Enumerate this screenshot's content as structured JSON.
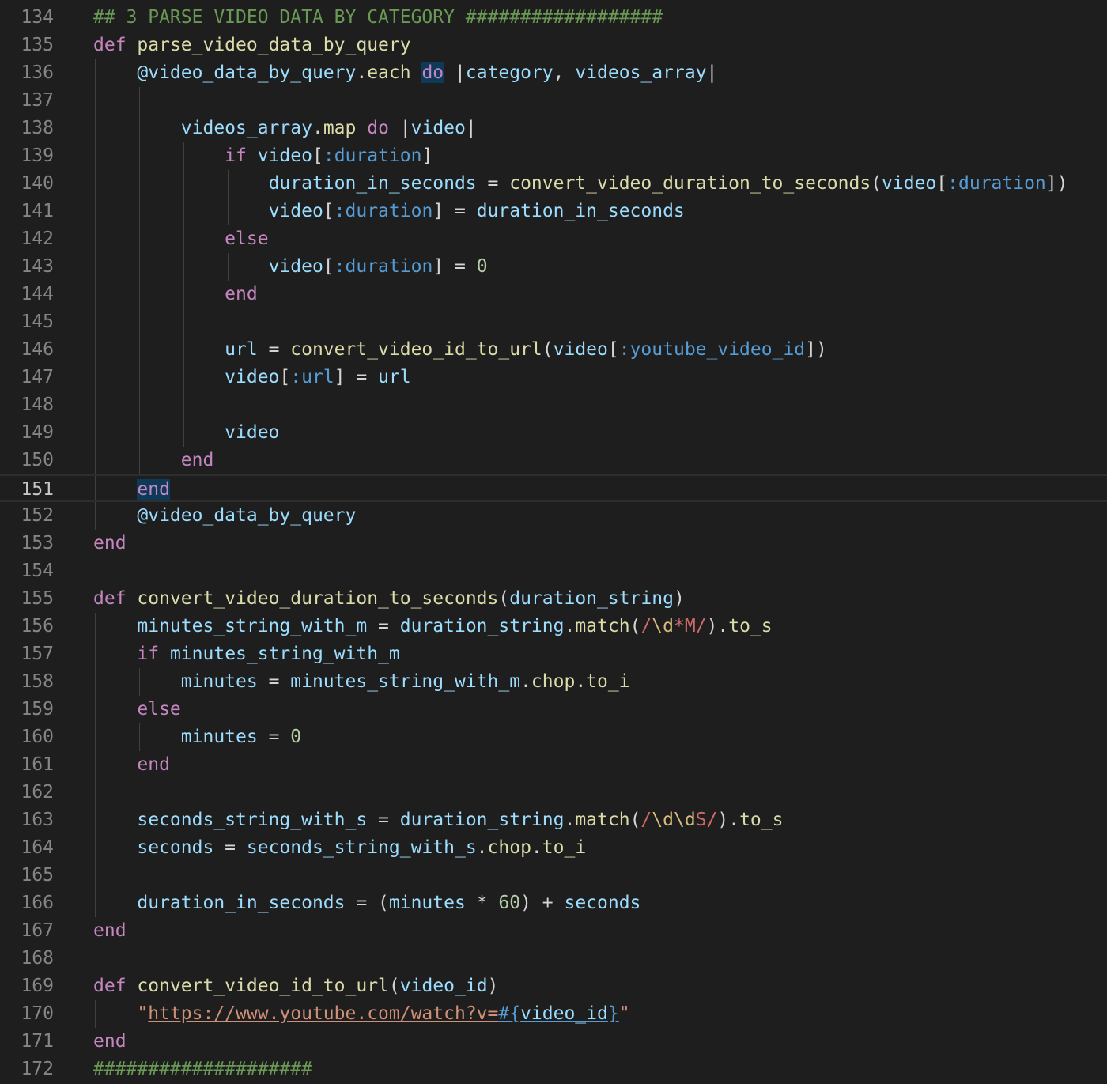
{
  "editor": {
    "language": "ruby",
    "current_line": 151,
    "lines": [
      {
        "n": "134",
        "tokens": [
          [
            "c",
            "## 3 PARSE VIDEO DATA BY CATEGORY ##################"
          ]
        ]
      },
      {
        "n": "135",
        "tokens": [
          [
            "k",
            "def"
          ],
          [
            "p",
            " "
          ],
          [
            "f",
            "parse_video_data_by_query"
          ]
        ]
      },
      {
        "n": "136",
        "tokens": [
          [
            "p",
            "    "
          ],
          [
            "v",
            "@video_data_by_query"
          ],
          [
            "p",
            "."
          ],
          [
            "f",
            "each"
          ],
          [
            "p",
            " "
          ],
          [
            "kh",
            "do"
          ],
          [
            "p",
            " |"
          ],
          [
            "v",
            "category"
          ],
          [
            "p",
            ", "
          ],
          [
            "v",
            "videos_array"
          ],
          [
            "p",
            "|"
          ]
        ]
      },
      {
        "n": "137",
        "tokens": []
      },
      {
        "n": "138",
        "tokens": [
          [
            "p",
            "        "
          ],
          [
            "v",
            "videos_array"
          ],
          [
            "p",
            "."
          ],
          [
            "f",
            "map"
          ],
          [
            "p",
            " "
          ],
          [
            "k",
            "do"
          ],
          [
            "p",
            " |"
          ],
          [
            "v",
            "video"
          ],
          [
            "p",
            "|"
          ]
        ]
      },
      {
        "n": "139",
        "tokens": [
          [
            "p",
            "            "
          ],
          [
            "k",
            "if"
          ],
          [
            "p",
            " "
          ],
          [
            "v",
            "video"
          ],
          [
            "p",
            "["
          ],
          [
            "s",
            ":duration"
          ],
          [
            "p",
            "]"
          ]
        ]
      },
      {
        "n": "140",
        "tokens": [
          [
            "p",
            "                "
          ],
          [
            "v",
            "duration_in_seconds"
          ],
          [
            "p",
            " = "
          ],
          [
            "f",
            "convert_video_duration_to_seconds"
          ],
          [
            "p",
            "("
          ],
          [
            "v",
            "video"
          ],
          [
            "p",
            "["
          ],
          [
            "s",
            ":duration"
          ],
          [
            "p",
            "])"
          ]
        ]
      },
      {
        "n": "141",
        "tokens": [
          [
            "p",
            "                "
          ],
          [
            "v",
            "video"
          ],
          [
            "p",
            "["
          ],
          [
            "s",
            ":duration"
          ],
          [
            "p",
            "] = "
          ],
          [
            "v",
            "duration_in_seconds"
          ]
        ]
      },
      {
        "n": "142",
        "tokens": [
          [
            "p",
            "            "
          ],
          [
            "k",
            "else"
          ]
        ]
      },
      {
        "n": "143",
        "tokens": [
          [
            "p",
            "                "
          ],
          [
            "v",
            "video"
          ],
          [
            "p",
            "["
          ],
          [
            "s",
            ":duration"
          ],
          [
            "p",
            "] = "
          ],
          [
            "n",
            "0"
          ]
        ]
      },
      {
        "n": "144",
        "tokens": [
          [
            "p",
            "            "
          ],
          [
            "k",
            "end"
          ]
        ]
      },
      {
        "n": "145",
        "tokens": []
      },
      {
        "n": "146",
        "tokens": [
          [
            "p",
            "            "
          ],
          [
            "v",
            "url"
          ],
          [
            "p",
            " = "
          ],
          [
            "f",
            "convert_video_id_to_url"
          ],
          [
            "p",
            "("
          ],
          [
            "v",
            "video"
          ],
          [
            "p",
            "["
          ],
          [
            "s",
            ":youtube_video_id"
          ],
          [
            "p",
            "])"
          ]
        ]
      },
      {
        "n": "147",
        "tokens": [
          [
            "p",
            "            "
          ],
          [
            "v",
            "video"
          ],
          [
            "p",
            "["
          ],
          [
            "s",
            ":url"
          ],
          [
            "p",
            "] = "
          ],
          [
            "v",
            "url"
          ]
        ]
      },
      {
        "n": "148",
        "tokens": []
      },
      {
        "n": "149",
        "tokens": [
          [
            "p",
            "            "
          ],
          [
            "v",
            "video"
          ]
        ]
      },
      {
        "n": "150",
        "tokens": [
          [
            "p",
            "        "
          ],
          [
            "k",
            "end"
          ]
        ]
      },
      {
        "n": "151",
        "tokens": [
          [
            "p",
            "    "
          ],
          [
            "kh",
            "end"
          ]
        ]
      },
      {
        "n": "152",
        "tokens": [
          [
            "p",
            "    "
          ],
          [
            "v",
            "@video_data_by_query"
          ]
        ]
      },
      {
        "n": "153",
        "tokens": [
          [
            "k",
            "end"
          ]
        ]
      },
      {
        "n": "154",
        "tokens": []
      },
      {
        "n": "155",
        "tokens": [
          [
            "k",
            "def"
          ],
          [
            "p",
            " "
          ],
          [
            "f",
            "convert_video_duration_to_seconds"
          ],
          [
            "p",
            "("
          ],
          [
            "v",
            "duration_string"
          ],
          [
            "p",
            ")"
          ]
        ]
      },
      {
        "n": "156",
        "tokens": [
          [
            "p",
            "    "
          ],
          [
            "v",
            "minutes_string_with_m"
          ],
          [
            "p",
            " = "
          ],
          [
            "v",
            "duration_string"
          ],
          [
            "p",
            "."
          ],
          [
            "f",
            "match"
          ],
          [
            "p",
            "("
          ],
          [
            "r",
            "/"
          ],
          [
            "rc",
            "\\d"
          ],
          [
            "r",
            "*M/"
          ],
          [
            "p",
            ")."
          ],
          [
            "f",
            "to_s"
          ]
        ]
      },
      {
        "n": "157",
        "tokens": [
          [
            "p",
            "    "
          ],
          [
            "k",
            "if"
          ],
          [
            "p",
            " "
          ],
          [
            "v",
            "minutes_string_with_m"
          ]
        ]
      },
      {
        "n": "158",
        "tokens": [
          [
            "p",
            "        "
          ],
          [
            "v",
            "minutes"
          ],
          [
            "p",
            " = "
          ],
          [
            "v",
            "minutes_string_with_m"
          ],
          [
            "p",
            "."
          ],
          [
            "f",
            "chop"
          ],
          [
            "p",
            "."
          ],
          [
            "f",
            "to_i"
          ]
        ]
      },
      {
        "n": "159",
        "tokens": [
          [
            "p",
            "    "
          ],
          [
            "k",
            "else"
          ]
        ]
      },
      {
        "n": "160",
        "tokens": [
          [
            "p",
            "        "
          ],
          [
            "v",
            "minutes"
          ],
          [
            "p",
            " = "
          ],
          [
            "n",
            "0"
          ]
        ]
      },
      {
        "n": "161",
        "tokens": [
          [
            "p",
            "    "
          ],
          [
            "k",
            "end"
          ]
        ]
      },
      {
        "n": "162",
        "tokens": []
      },
      {
        "n": "163",
        "tokens": [
          [
            "p",
            "    "
          ],
          [
            "v",
            "seconds_string_with_s"
          ],
          [
            "p",
            " = "
          ],
          [
            "v",
            "duration_string"
          ],
          [
            "p",
            "."
          ],
          [
            "f",
            "match"
          ],
          [
            "p",
            "("
          ],
          [
            "r",
            "/"
          ],
          [
            "rc",
            "\\d\\d"
          ],
          [
            "r",
            "S/"
          ],
          [
            "p",
            ")."
          ],
          [
            "f",
            "to_s"
          ]
        ]
      },
      {
        "n": "164",
        "tokens": [
          [
            "p",
            "    "
          ],
          [
            "v",
            "seconds"
          ],
          [
            "p",
            " = "
          ],
          [
            "v",
            "seconds_string_with_s"
          ],
          [
            "p",
            "."
          ],
          [
            "f",
            "chop"
          ],
          [
            "p",
            "."
          ],
          [
            "f",
            "to_i"
          ]
        ]
      },
      {
        "n": "165",
        "tokens": []
      },
      {
        "n": "166",
        "tokens": [
          [
            "p",
            "    "
          ],
          [
            "v",
            "duration_in_seconds"
          ],
          [
            "p",
            " = ("
          ],
          [
            "v",
            "minutes"
          ],
          [
            "p",
            " * "
          ],
          [
            "n",
            "60"
          ],
          [
            "p",
            ") + "
          ],
          [
            "v",
            "seconds"
          ]
        ]
      },
      {
        "n": "167",
        "tokens": [
          [
            "k",
            "end"
          ]
        ]
      },
      {
        "n": "168",
        "tokens": []
      },
      {
        "n": "169",
        "tokens": [
          [
            "k",
            "def"
          ],
          [
            "p",
            " "
          ],
          [
            "f",
            "convert_video_id_to_url"
          ],
          [
            "p",
            "("
          ],
          [
            "v",
            "video_id"
          ],
          [
            "p",
            ")"
          ]
        ]
      },
      {
        "n": "170",
        "tokens": [
          [
            "p",
            "    "
          ],
          [
            "str",
            "\""
          ],
          [
            "strl",
            "https://www.youtube.com/watch?v="
          ],
          [
            "sl",
            "#{"
          ],
          [
            "vl",
            "video_id"
          ],
          [
            "sl",
            "}"
          ],
          [
            "str",
            "\""
          ]
        ]
      },
      {
        "n": "171",
        "tokens": [
          [
            "k",
            "end"
          ]
        ]
      },
      {
        "n": "172",
        "tokens": [
          [
            "c",
            "####################"
          ]
        ]
      }
    ]
  }
}
